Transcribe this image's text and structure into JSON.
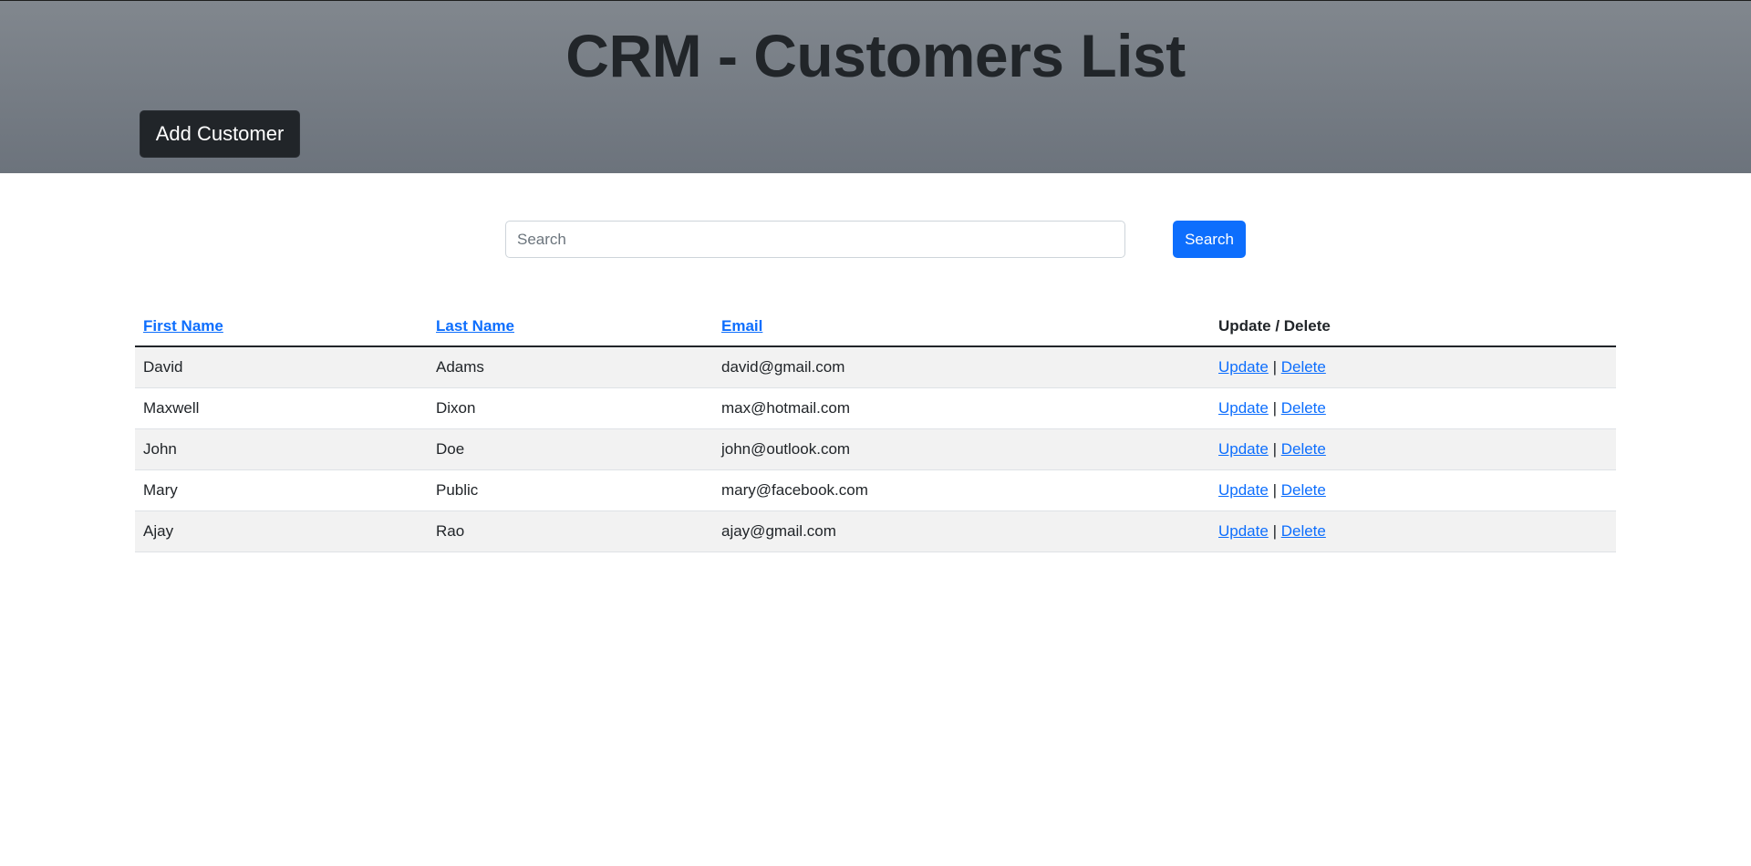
{
  "header": {
    "title": "CRM - Customers List",
    "add_button_label": "Add Customer"
  },
  "search": {
    "placeholder": "Search",
    "value": "",
    "button_label": "Search"
  },
  "table": {
    "columns": [
      {
        "label": "First Name",
        "sortable": true
      },
      {
        "label": "Last Name",
        "sortable": true
      },
      {
        "label": "Email",
        "sortable": true
      },
      {
        "label": "Update / Delete",
        "sortable": false
      }
    ],
    "rows": [
      {
        "first_name": "David",
        "last_name": "Adams",
        "email": "david@gmail.com",
        "update": "Update",
        "sep": "|",
        "delete": "Delete"
      },
      {
        "first_name": "Maxwell",
        "last_name": "Dixon",
        "email": "max@hotmail.com",
        "update": "Update",
        "sep": "|",
        "delete": "Delete"
      },
      {
        "first_name": "John",
        "last_name": "Doe",
        "email": "john@outlook.com",
        "update": "Update",
        "sep": "|",
        "delete": "Delete"
      },
      {
        "first_name": "Mary",
        "last_name": "Public",
        "email": "mary@facebook.com",
        "update": "Update",
        "sep": "|",
        "delete": "Delete"
      },
      {
        "first_name": "Ajay",
        "last_name": "Rao",
        "email": "ajay@gmail.com",
        "update": "Update",
        "sep": "|",
        "delete": "Delete"
      }
    ]
  },
  "colors": {
    "primary": "#0d6efd",
    "dark": "#212529",
    "header_gradient_top": "#81878e",
    "header_gradient_bottom": "#6c737c",
    "row_stripe": "#f2f2f2"
  }
}
